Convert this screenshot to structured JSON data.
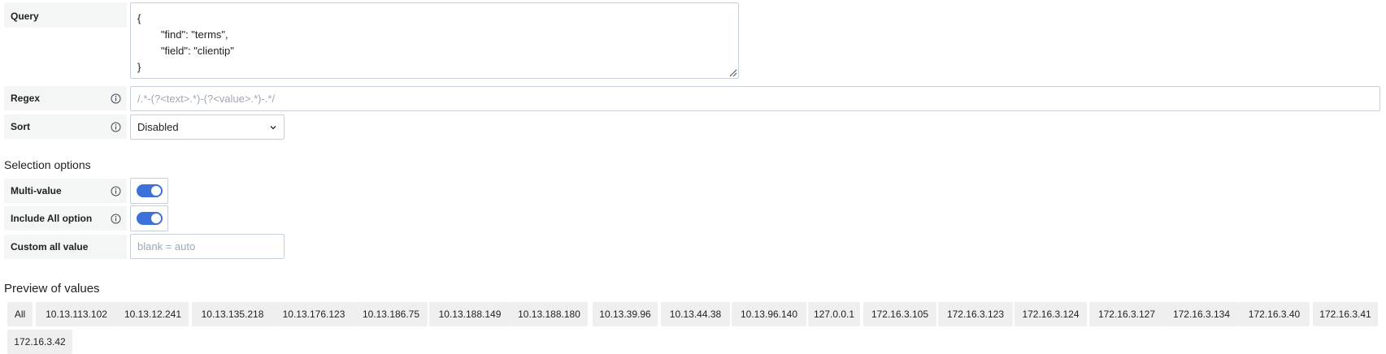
{
  "query": {
    "label": "Query",
    "lines": [
      "{",
      "        \"find\": \"terms\",",
      "        \"field\": \"clientip\"",
      "}"
    ]
  },
  "regex": {
    "label": "Regex",
    "placeholder": "/.*-(?<text>.*)-(?<value>.*)-.*/"
  },
  "sort": {
    "label": "Sort",
    "value": "Disabled"
  },
  "selection_options": {
    "title": "Selection options",
    "multi_value": {
      "label": "Multi-value",
      "enabled": true
    },
    "include_all": {
      "label": "Include All option",
      "enabled": true
    },
    "custom_all": {
      "label": "Custom all value",
      "placeholder": "blank = auto"
    }
  },
  "preview": {
    "title": "Preview of values",
    "values": [
      "All",
      "10.13.113.102",
      "10.13.12.241",
      "10.13.135.218",
      "10.13.176.123",
      "10.13.186.75",
      "10.13.188.149",
      "10.13.188.180",
      "10.13.39.96",
      "10.13.44.38",
      "10.13.96.140",
      "127.0.0.1",
      "172.16.3.105",
      "172.16.3.123",
      "172.16.3.124",
      "172.16.3.127",
      "172.16.3.134",
      "172.16.3.40",
      "172.16.3.41",
      "172.16.3.42"
    ]
  },
  "colors": {
    "toggle_on": "#3d71d9",
    "label_bg": "#f4f5f5",
    "chip_bg": "#efefef"
  }
}
